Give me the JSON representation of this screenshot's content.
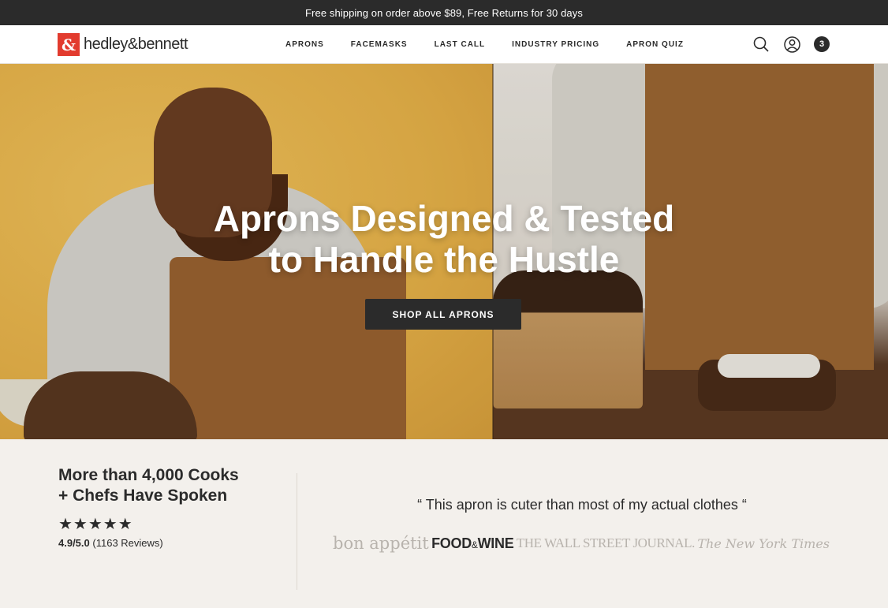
{
  "announcement": "Free shipping on order above $89, Free Returns for 30 days",
  "brand": {
    "mark": "&",
    "name": "hedley&bennett",
    "color": "#e23b2e"
  },
  "nav": {
    "items": [
      "APRONS",
      "FACEMASKS",
      "LAST CALL",
      "INDUSTRY PRICING",
      "APRON QUIZ"
    ],
    "icons": [
      "search-icon",
      "account-icon"
    ],
    "cart_count": "3"
  },
  "hero": {
    "title_line1": "Aprons Designed & Tested",
    "title_line2": "to Handle the Hustle",
    "cta": "SHOP ALL APRONS"
  },
  "reviews": {
    "heading_line1": "More than 4,000 Cooks",
    "heading_line2": "+ Chefs Have Spoken",
    "stars": "★★★★★",
    "rating": "4.9/5.0",
    "count": "(1163 Reviews)",
    "quote": "“ This apron is cuter than most of my actual clothes “",
    "press": {
      "bon_appetit": "bon appétit",
      "food_wine_a": "FOOD",
      "food_wine_amp": "&",
      "food_wine_b": "WINE",
      "wsj": "THE WALL STREET JOURNAL.",
      "nyt": "The New York Times"
    }
  }
}
